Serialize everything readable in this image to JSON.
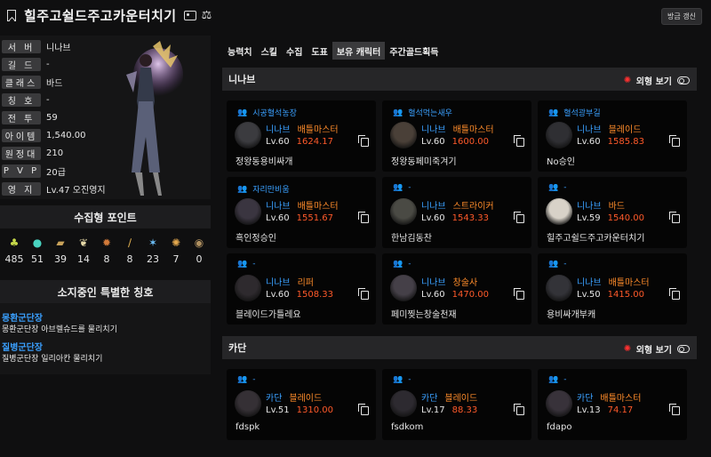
{
  "header": {
    "title": "힐주고쉴드주고카운터치기",
    "refresh_label": "방금 갱신"
  },
  "profile": {
    "rows": [
      {
        "label": "서 버",
        "value": "니나브"
      },
      {
        "label": "길 드",
        "value": "-"
      },
      {
        "label": "클래스",
        "value": "바드"
      },
      {
        "label": "칭 호",
        "value": "-"
      },
      {
        "label": "전 투",
        "value": "59"
      },
      {
        "label": "아이템",
        "value": "1,540.00"
      },
      {
        "label": "원정대",
        "value": "210"
      },
      {
        "label": "P V P",
        "value": "20급"
      },
      {
        "label": "영 지",
        "value": "Lv.47 오진영지"
      }
    ]
  },
  "collection": {
    "title": "수집형 포인트",
    "items": [
      {
        "icon": "island-heart-icon",
        "value": "485"
      },
      {
        "icon": "orb-icon",
        "value": "51"
      },
      {
        "icon": "art-icon",
        "value": "39"
      },
      {
        "icon": "mokoko-icon",
        "value": "14"
      },
      {
        "icon": "ignea-icon",
        "value": "8"
      },
      {
        "icon": "leaf-icon",
        "value": "8"
      },
      {
        "icon": "star-icon",
        "value": "23"
      },
      {
        "icon": "voyage-icon",
        "value": "7"
      },
      {
        "icon": "medal-icon",
        "value": "0"
      }
    ]
  },
  "special_titles": {
    "title": "소지중인 특별한 칭호",
    "items": [
      {
        "name": "몽환군단장",
        "desc": "몽환군단장 아브렐슈드를 물리치기"
      },
      {
        "name": "질병군단장",
        "desc": "질병군단장 일리아칸 물리치기"
      }
    ]
  },
  "tabs": [
    "능력치",
    "스킬",
    "수집",
    "도표",
    "보유 캐릭터",
    "주간골드획득"
  ],
  "active_tab": "보유 캐릭터",
  "appearance_label": "외형 보기",
  "servers": [
    {
      "name": "니나브",
      "characters": [
        {
          "guild": "시공혈석농장",
          "server": "니나브",
          "class": "배틀마스터",
          "lv": "Lv.60",
          "ilvl": "1624.17",
          "name": "정왕동용비싸개"
        },
        {
          "guild": "혈석먹는새우",
          "server": "니나브",
          "class": "배틀마스터",
          "lv": "Lv.60",
          "ilvl": "1600.00",
          "name": "정왕동페미죽겨기"
        },
        {
          "guild": "혈석광부길",
          "server": "니나브",
          "class": "블레이드",
          "lv": "Lv.60",
          "ilvl": "1585.83",
          "name": "No승인"
        },
        {
          "guild": "자리만비움",
          "server": "니나브",
          "class": "배틀마스터",
          "lv": "Lv.60",
          "ilvl": "1551.67",
          "name": "흑인정승인"
        },
        {
          "guild": "-",
          "server": "니나브",
          "class": "스트라이커",
          "lv": "Lv.60",
          "ilvl": "1543.33",
          "name": "한남김동찬"
        },
        {
          "guild": "-",
          "server": "니나브",
          "class": "바드",
          "lv": "Lv.59",
          "ilvl": "1540.00",
          "name": "힐주고쉴드주고카운터치기"
        },
        {
          "guild": "-",
          "server": "니나브",
          "class": "리퍼",
          "lv": "Lv.60",
          "ilvl": "1508.33",
          "name": "블레이드가틀레요"
        },
        {
          "guild": "-",
          "server": "니나브",
          "class": "창술사",
          "lv": "Lv.60",
          "ilvl": "1470.00",
          "name": "페미찢는창술천재"
        },
        {
          "guild": "-",
          "server": "니나브",
          "class": "배틀마스터",
          "lv": "Lv.50",
          "ilvl": "1415.00",
          "name": "용비싸개부캐"
        }
      ]
    },
    {
      "name": "카단",
      "characters": [
        {
          "guild": "-",
          "server": "카단",
          "class": "블레이드",
          "lv": "Lv.51",
          "ilvl": "1310.00",
          "name": "fdspk"
        },
        {
          "guild": "-",
          "server": "카단",
          "class": "블레이드",
          "lv": "Lv.17",
          "ilvl": "88.33",
          "name": "fsdkom"
        },
        {
          "guild": "-",
          "server": "카단",
          "class": "배틀마스터",
          "lv": "Lv.13",
          "ilvl": "74.17",
          "name": "fdapo"
        }
      ]
    }
  ]
}
